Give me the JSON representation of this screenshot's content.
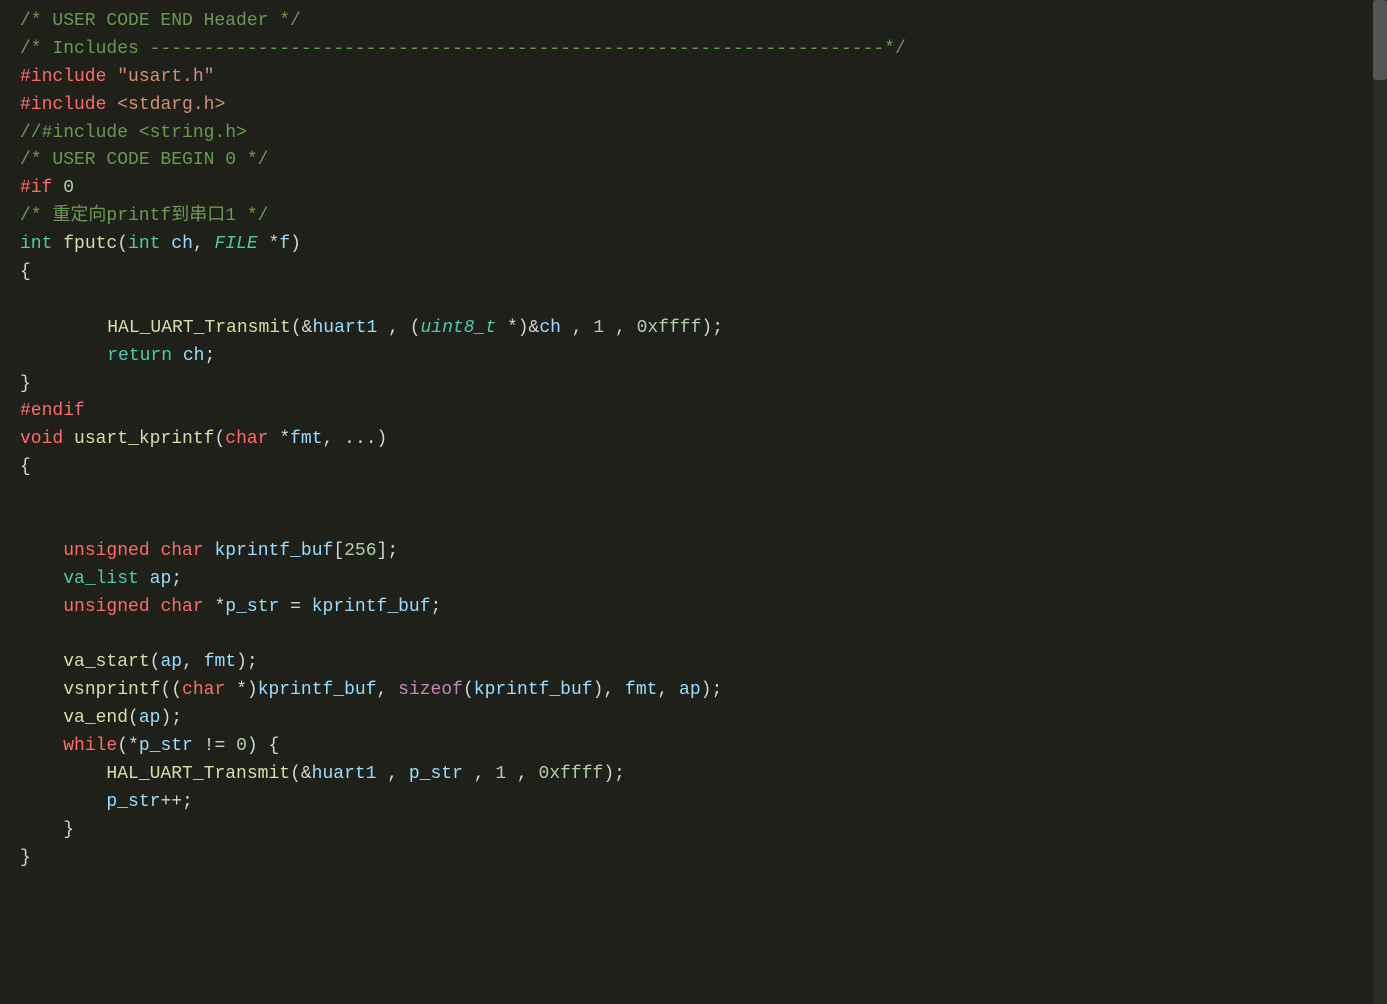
{
  "editor": {
    "background": "#1e2019",
    "lines": [
      {
        "id": 1,
        "content": "comment_end_header"
      },
      {
        "id": 2,
        "content": "comment_includes"
      },
      {
        "id": 3,
        "content": "include_usart"
      },
      {
        "id": 4,
        "content": "include_stdarg"
      },
      {
        "id": 5,
        "content": "commented_string"
      },
      {
        "id": 6,
        "content": "user_code_begin"
      },
      {
        "id": 7,
        "content": "if_0"
      },
      {
        "id": 8,
        "content": "comment_redirect"
      },
      {
        "id": 9,
        "content": "fputc_decl"
      },
      {
        "id": 10,
        "content": "open_brace"
      },
      {
        "id": 11,
        "content": "blank"
      },
      {
        "id": 12,
        "content": "hal_transmit_1"
      },
      {
        "id": 13,
        "content": "return_ch"
      },
      {
        "id": 14,
        "content": "close_brace"
      },
      {
        "id": 15,
        "content": "endif"
      },
      {
        "id": 16,
        "content": "usart_kprintf_decl"
      },
      {
        "id": 17,
        "content": "open_brace2"
      },
      {
        "id": 18,
        "content": "blank2"
      },
      {
        "id": 19,
        "content": "blank3"
      },
      {
        "id": 20,
        "content": "unsigned_char_buf"
      },
      {
        "id": 21,
        "content": "va_list_ap"
      },
      {
        "id": 22,
        "content": "unsigned_char_pstr"
      },
      {
        "id": 23,
        "content": "blank4"
      },
      {
        "id": 24,
        "content": "va_start"
      },
      {
        "id": 25,
        "content": "vsnprintf"
      },
      {
        "id": 26,
        "content": "va_end"
      },
      {
        "id": 27,
        "content": "while_loop"
      },
      {
        "id": 28,
        "content": "hal_transmit_2"
      },
      {
        "id": 29,
        "content": "pstr_increment"
      },
      {
        "id": 30,
        "content": "close_while"
      },
      {
        "id": 31,
        "content": "close_brace2"
      }
    ]
  }
}
